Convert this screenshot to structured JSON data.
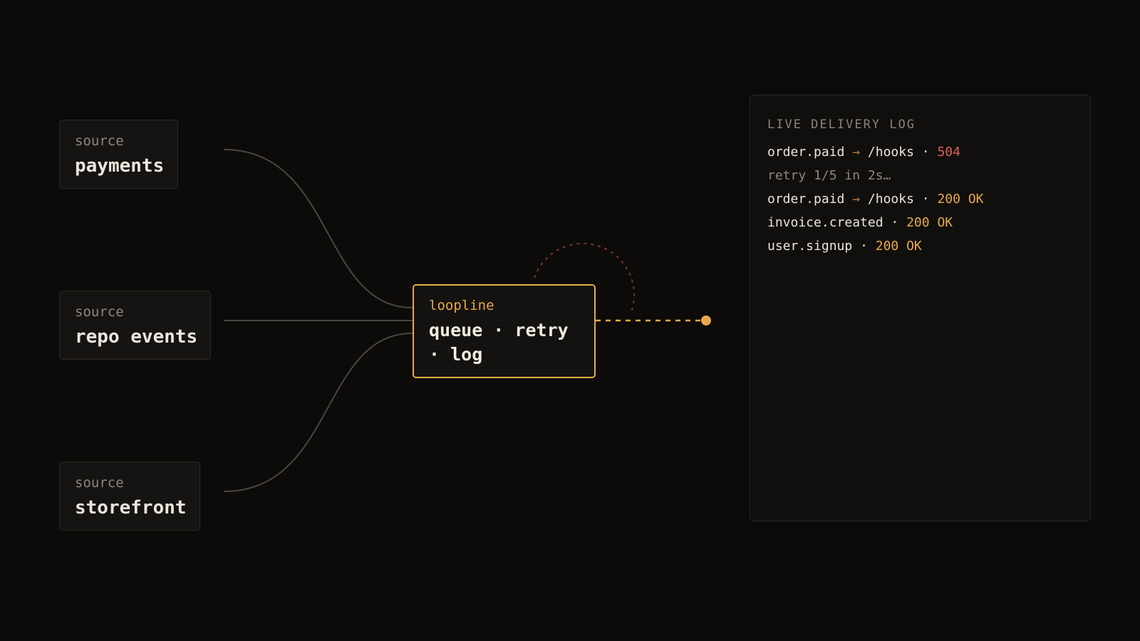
{
  "sources": [
    {
      "kind": "source",
      "name": "payments"
    },
    {
      "kind": "source",
      "name": "repo events"
    },
    {
      "kind": "source",
      "name": "storefront"
    }
  ],
  "hub": {
    "name": "loopline",
    "line1": "queue · retry",
    "line2": "· log"
  },
  "log": {
    "title": "LIVE DELIVERY LOG",
    "entries": [
      {
        "event": "order.paid",
        "arrow": "→",
        "target": "/hooks",
        "sep": "·",
        "status": "504",
        "status_kind": "error"
      },
      {
        "text": "retry 1/5 in 2s…"
      },
      {
        "event": "order.paid",
        "arrow": "→",
        "target": "/hooks",
        "sep": "·",
        "status": "200 OK",
        "status_kind": "ok"
      },
      {
        "event": "invoice.created",
        "sep": "·",
        "status": "200 OK",
        "status_kind": "ok"
      },
      {
        "event": "user.signup",
        "sep": "·",
        "status": "200 OK",
        "status_kind": "ok"
      }
    ]
  },
  "colors": {
    "accent": "#e8a94e",
    "error": "#e0605a",
    "wire": "#4a4640",
    "retry_arc": "#7a3530"
  }
}
